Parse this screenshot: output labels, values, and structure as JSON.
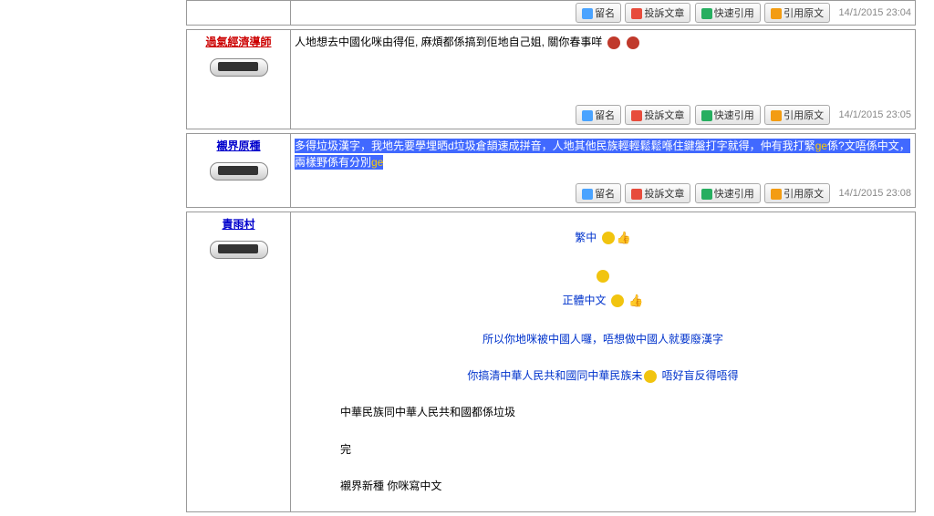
{
  "buttons": {
    "reply": "留名",
    "report": "投訴文章",
    "quickquote": "快速引用",
    "quote": "引用原文"
  },
  "posts": [
    {
      "timestamp": "14/1/2015 23:04"
    },
    {
      "author": "過氣經濟導師",
      "body": "人地想去中國化咪由得佢, 麻煩都係搞到佢地自己姐, 關你春事咩",
      "timestamp": "14/1/2015 23:05"
    },
    {
      "author": "襯界原種",
      "body1": "多得垃圾漢字，我地先要學埋晒d垃圾倉頡速成拼音，人地其他民族輕輕鬆鬆喺住鍵盤打字就得，仲有我打緊",
      "body2": "係?文唔係中文，兩樣野係有分別",
      "orange": "ge",
      "timestamp": "14/1/2015 23:08"
    },
    {
      "author": "責雨村",
      "lines": {
        "l1": "繁中",
        "l2": "正體中文",
        "l3": "所以你地咪被中國人囉，唔想做中國人就要廢漢字",
        "l4a": "你搞清中華人民共和國同中華民族未",
        "l4b": "唔好盲反得唔得",
        "l5": "中華民族同中華人民共和國都係垃圾",
        "l6": "完",
        "l7": "襯界新種 你咪寫中文"
      }
    }
  ]
}
